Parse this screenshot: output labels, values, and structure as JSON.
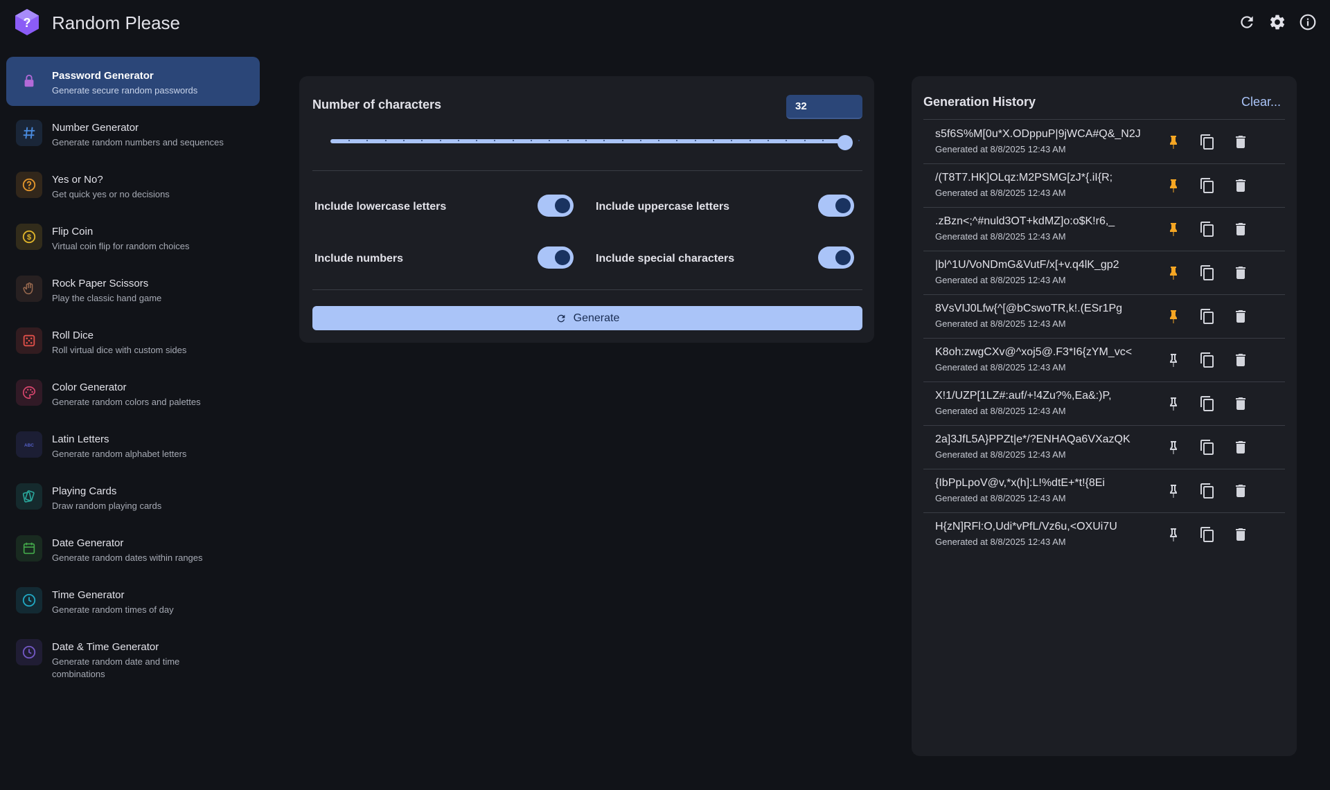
{
  "app": {
    "title": "Random Please"
  },
  "header": {
    "refresh_icon": "refresh-icon",
    "settings_icon": "gear-icon",
    "info_icon": "info-icon"
  },
  "colors": {
    "background": "#111318",
    "panel": "#1c1e24",
    "accent": "#aac4f8",
    "active_nav": "#2b4678",
    "pinned": "#f5a623"
  },
  "sidebar": {
    "items": [
      {
        "title": "Password Generator",
        "subtitle": "Generate secure random passwords",
        "icon": "lock-icon",
        "color": "#b36ad8",
        "active": true
      },
      {
        "title": "Number Generator",
        "subtitle": "Generate random numbers and sequences",
        "icon": "hash-icon",
        "color": "#4a8ce0"
      },
      {
        "title": "Yes or No?",
        "subtitle": "Get quick yes or no decisions",
        "icon": "question-icon",
        "color": "#e3962c"
      },
      {
        "title": "Flip Coin",
        "subtitle": "Virtual coin flip for random choices",
        "icon": "coin-icon",
        "color": "#e0b52a"
      },
      {
        "title": "Rock Paper Scissors",
        "subtitle": "Play the classic hand game",
        "icon": "hand-icon",
        "color": "#9a6a4f"
      },
      {
        "title": "Roll Dice",
        "subtitle": "Roll virtual dice with custom sides",
        "icon": "dice-icon",
        "color": "#e0504a"
      },
      {
        "title": "Color Generator",
        "subtitle": "Generate random colors and palettes",
        "icon": "palette-icon",
        "color": "#d8466e"
      },
      {
        "title": "Latin Letters",
        "subtitle": "Generate random alphabet letters",
        "icon": "abc-icon",
        "color": "#5560c8",
        "icon_text": "ABC"
      },
      {
        "title": "Playing Cards",
        "subtitle": "Draw random playing cards",
        "icon": "cards-icon",
        "color": "#2aa59a"
      },
      {
        "title": "Date Generator",
        "subtitle": "Generate random dates within ranges",
        "icon": "calendar-icon",
        "color": "#43a84a"
      },
      {
        "title": "Time Generator",
        "subtitle": "Generate random times of day",
        "icon": "clock-icon",
        "color": "#21a7c2"
      },
      {
        "title": "Date & Time Generator",
        "subtitle": "Generate random date and time combinations",
        "icon": "clock-icon",
        "color": "#7358c4"
      }
    ]
  },
  "generator": {
    "length_label": "Number of characters",
    "length_value": "32",
    "slider_fraction": 1.0,
    "options": [
      {
        "label": "Include lowercase letters",
        "enabled": true
      },
      {
        "label": "Include uppercase letters",
        "enabled": true
      },
      {
        "label": "Include numbers",
        "enabled": true
      },
      {
        "label": "Include special characters",
        "enabled": true
      }
    ],
    "generate_label": "Generate"
  },
  "history": {
    "title": "Generation History",
    "clear_label": "Clear...",
    "entries": [
      {
        "value": "s5f6S%M[0u*X.ODppuP|9jWCA#Q&_N2J",
        "time": "Generated at 8/8/2025 12:43 AM",
        "pinned": true
      },
      {
        "value": "/(T8T7.HK]OLqz:M2PSMG[zJ*{.iI{R;",
        "time": "Generated at 8/8/2025 12:43 AM",
        "pinned": true
      },
      {
        "value": ".zBzn<;^#nuld3OT+kdMZ]o:o$K!r6,_",
        "time": "Generated at 8/8/2025 12:43 AM",
        "pinned": true
      },
      {
        "value": "|bl^1U/VoNDmG&VutF/x[+v.q4lK_gp2",
        "time": "Generated at 8/8/2025 12:43 AM",
        "pinned": true
      },
      {
        "value": "8VsVIJ0Lfw{^[@bCswoTR,k!.(ESr1Pg",
        "time": "Generated at 8/8/2025 12:43 AM",
        "pinned": true
      },
      {
        "value": "K8oh:zwgCXv@^xoj5@.F3*I6{zYM_vc<",
        "time": "Generated at 8/8/2025 12:43 AM",
        "pinned": false
      },
      {
        "value": "X!1/UZP[1LZ#:auf/+!4Zu?%,Ea&:)P,",
        "time": "Generated at 8/8/2025 12:43 AM",
        "pinned": false
      },
      {
        "value": "2a]3JfL5A}PPZt|e*/?ENHAQa6VXazQK",
        "time": "Generated at 8/8/2025 12:43 AM",
        "pinned": false
      },
      {
        "value": "{IbPpLpoV@v,*x(h]:L!%dtE+*t!{8Ei",
        "time": "Generated at 8/8/2025 12:43 AM",
        "pinned": false
      },
      {
        "value": "H{zN]RFl:O,Udi*vPfL/Vz6u,<OXUi7U",
        "time": "Generated at 8/8/2025 12:43 AM",
        "pinned": false
      }
    ]
  }
}
